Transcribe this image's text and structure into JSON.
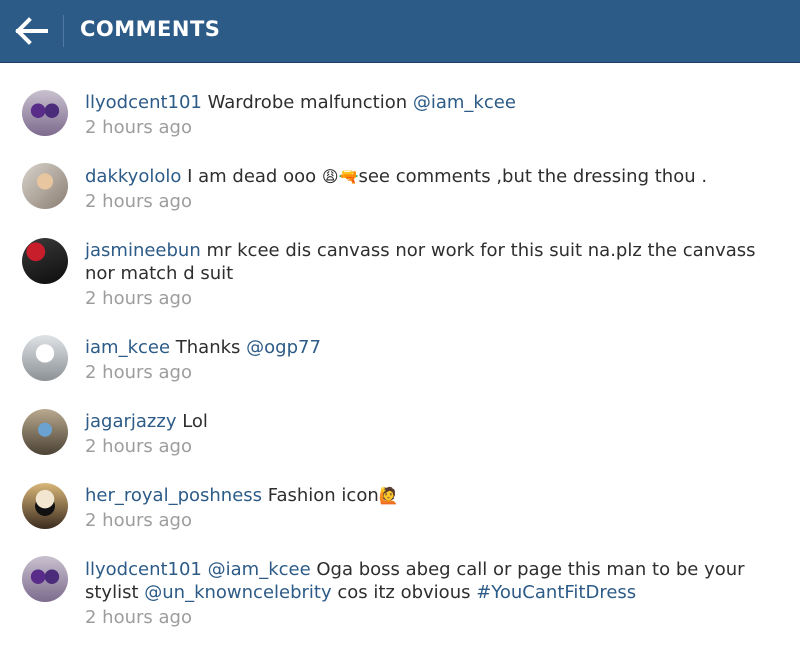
{
  "header": {
    "title": "COMMENTS",
    "back_icon": "arrow-left-icon",
    "bg_color": "#2d5b87"
  },
  "comments": [
    {
      "username": "llyodcent101",
      "parts": [
        {
          "text": " Wardrobe malfunction "
        },
        {
          "text": "@iam_kcee",
          "link": true
        }
      ],
      "time": "2 hours ago"
    },
    {
      "username": "dakkyololo",
      "parts": [
        {
          "text": " I am dead ooo "
        },
        {
          "text": "😩",
          "emoji": true
        },
        {
          "text": "🔫",
          "emoji": true
        },
        {
          "text": "see comments ,but the dressing thou ."
        }
      ],
      "time": "2 hours ago"
    },
    {
      "username": "jasmineebun",
      "parts": [
        {
          "text": " mr kcee  dis canvass nor work for this suit na.plz the canvass nor match d suit"
        }
      ],
      "time": "2 hours ago"
    },
    {
      "username": "iam_kcee",
      "parts": [
        {
          "text": " Thanks "
        },
        {
          "text": "@ogp77",
          "link": true
        }
      ],
      "time": "2 hours ago"
    },
    {
      "username": "jagarjazzy",
      "parts": [
        {
          "text": " Lol"
        }
      ],
      "time": "2 hours ago"
    },
    {
      "username": "her_royal_poshness",
      "parts": [
        {
          "text": " Fashion icon"
        },
        {
          "text": "🙋",
          "emoji": true
        }
      ],
      "time": "2 hours ago"
    },
    {
      "username": "llyodcent101",
      "parts": [
        {
          "text": " "
        },
        {
          "text": "@iam_kcee",
          "link": true
        },
        {
          "text": " Oga boss abeg call or page this man to be your stylist "
        },
        {
          "text": "@un_knowncelebrity",
          "link": true
        },
        {
          "text": " cos itz obvious "
        },
        {
          "text": "#YouCantFitDress",
          "link": true
        }
      ],
      "time": "2 hours ago"
    }
  ]
}
